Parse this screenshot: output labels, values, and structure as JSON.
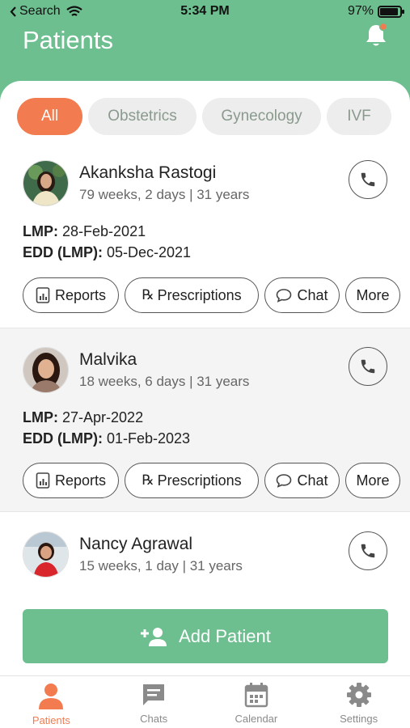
{
  "status_bar": {
    "back_label": "Search",
    "time": "5:34 PM",
    "battery": "97%"
  },
  "header": {
    "title": "Patients"
  },
  "filters": [
    {
      "label": "All",
      "active": true
    },
    {
      "label": "Obstetrics",
      "active": false
    },
    {
      "label": "Gynecology",
      "active": false
    },
    {
      "label": "IVF",
      "active": false
    }
  ],
  "patients": [
    {
      "name": "Akanksha Rastogi",
      "info": "79 weeks, 2 days | 31 years",
      "lmp_label": "LMP:",
      "lmp": "28-Feb-2021",
      "edd_label": "EDD (LMP):",
      "edd": "05-Dec-2021"
    },
    {
      "name": "Malvika",
      "info": "18 weeks, 6 days | 31 years",
      "lmp_label": "LMP:",
      "lmp": "27-Apr-2022",
      "edd_label": "EDD (LMP):",
      "edd": "01-Feb-2023"
    },
    {
      "name": "Nancy Agrawal",
      "info": "15 weeks, 1 day | 31 years"
    }
  ],
  "actions": {
    "reports": "Reports",
    "prescriptions": "Prescriptions",
    "chat": "Chat",
    "more": "More"
  },
  "add_patient": {
    "label": "Add Patient"
  },
  "tabbar": [
    {
      "label": "Patients",
      "icon": "person-icon",
      "active": true
    },
    {
      "label": "Chats",
      "icon": "chat-icon",
      "active": false
    },
    {
      "label": "Calendar",
      "icon": "calendar-icon",
      "active": false
    },
    {
      "label": "Settings",
      "icon": "gear-icon",
      "active": false
    }
  ],
  "colors": {
    "brand_green": "#6dbf8f",
    "accent_orange": "#f27b4f"
  }
}
